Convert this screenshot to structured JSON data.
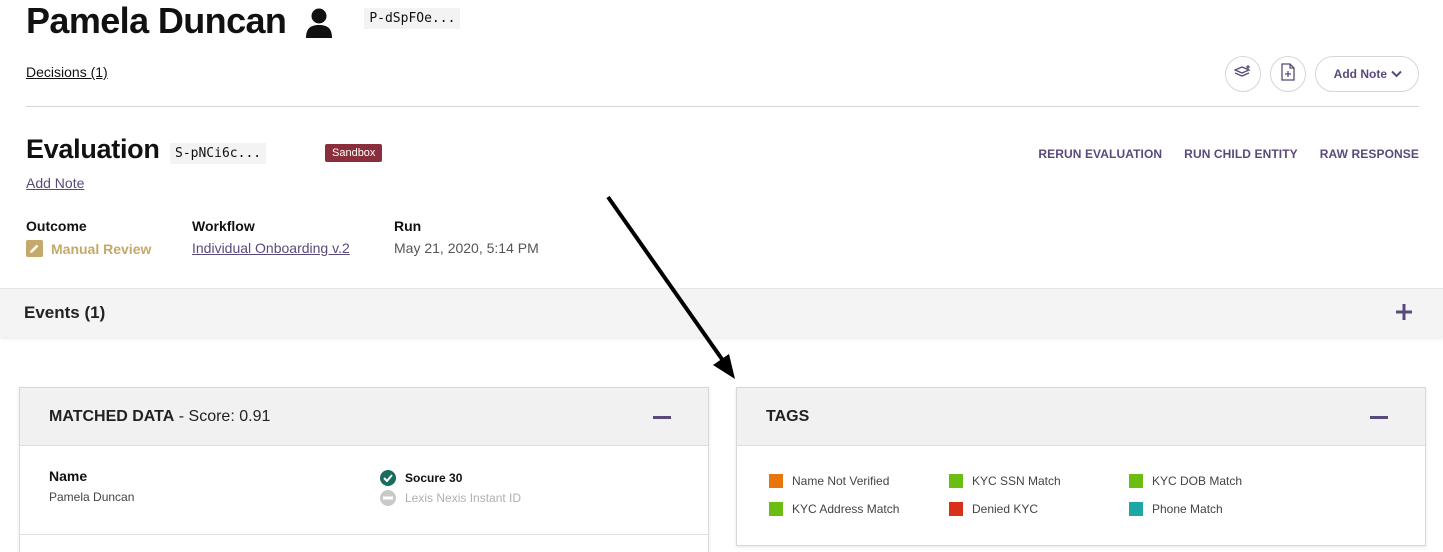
{
  "entity": {
    "name": "Pamela Duncan",
    "id_chip": "P-dSpFOe..."
  },
  "decisions_link": "Decisions (1)",
  "top_actions": {
    "add_note_label": "Add Note"
  },
  "evaluation": {
    "title": "Evaluation",
    "id_chip": "S-pNCi6c...",
    "badge": "Sandbox",
    "add_note": "Add Note",
    "actions": [
      "RERUN EVALUATION",
      "RUN CHILD ENTITY",
      "RAW RESPONSE"
    ],
    "outcome_label": "Outcome",
    "outcome_value": "Manual Review",
    "workflow_label": "Workflow",
    "workflow_value": "Individual Onboarding v.2",
    "run_label": "Run",
    "run_value": "May 21, 2020, 5:14 PM"
  },
  "events": {
    "title": "Events (1)"
  },
  "matched_data": {
    "title": "MATCHED DATA",
    "score_text": " - Score: 0.91",
    "field_label": "Name",
    "field_value": "Pamela Duncan",
    "sources": [
      {
        "label": "Socure 30",
        "status": "matched",
        "icon": "check-circle-icon"
      },
      {
        "label": "Lexis Nexis Instant ID",
        "status": "not-applicable",
        "icon": "minus-circle-icon"
      }
    ]
  },
  "tags": {
    "title": "TAGS",
    "items": [
      {
        "label": "Name Not Verified",
        "color": "#e8760a"
      },
      {
        "label": "KYC SSN Match",
        "color": "#6cbd12"
      },
      {
        "label": "KYC DOB Match",
        "color": "#6cbd12"
      },
      {
        "label": "KYC Address Match",
        "color": "#6cbd12"
      },
      {
        "label": "Denied KYC",
        "color": "#d9301c"
      },
      {
        "label": "Phone Match",
        "color": "#1ea7a7"
      }
    ]
  },
  "colors": {
    "accent": "#5a4a7a",
    "sandbox": "#8a2e3c",
    "manual_review": "#c4a96a",
    "check": "#1b6b5f"
  }
}
